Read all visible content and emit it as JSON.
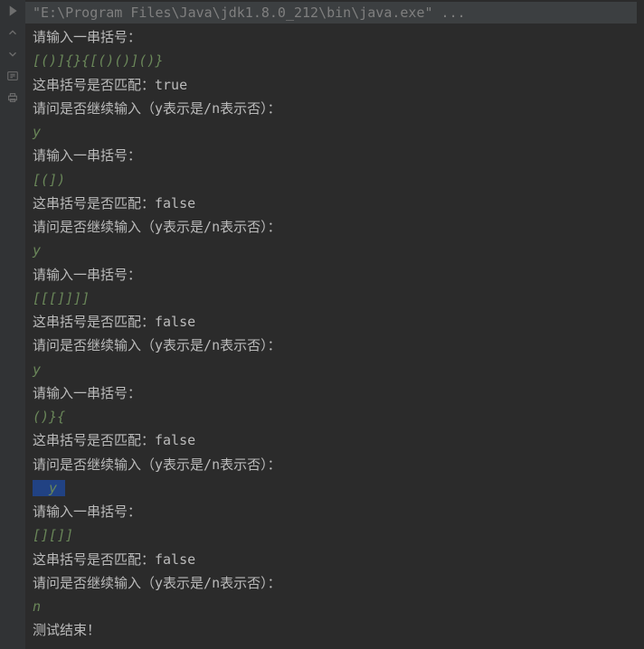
{
  "header": "\"E:\\Program Files\\Java\\jdk1.8.0_212\\bin\\java.exe\" ...",
  "lines": [
    {
      "type": "out",
      "text": "请输入一串括号："
    },
    {
      "type": "in",
      "text": "[()]{}{[()()]()}"
    },
    {
      "type": "out",
      "text": "这串括号是否匹配：true"
    },
    {
      "type": "out",
      "text": "请问是否继续输入（y表示是/n表示否）："
    },
    {
      "type": "in",
      "text": "y"
    },
    {
      "type": "out",
      "text": "请输入一串括号："
    },
    {
      "type": "in",
      "text": "[(])"
    },
    {
      "type": "out",
      "text": "这串括号是否匹配：false"
    },
    {
      "type": "out",
      "text": "请问是否继续输入（y表示是/n表示否）："
    },
    {
      "type": "in",
      "text": "y"
    },
    {
      "type": "out",
      "text": "请输入一串括号："
    },
    {
      "type": "in",
      "text": "[[[]]]]"
    },
    {
      "type": "out",
      "text": "这串括号是否匹配：false"
    },
    {
      "type": "out",
      "text": "请问是否继续输入（y表示是/n表示否）："
    },
    {
      "type": "in",
      "text": "y"
    },
    {
      "type": "out",
      "text": "请输入一串括号："
    },
    {
      "type": "in",
      "text": "()}{"
    },
    {
      "type": "out",
      "text": "这串括号是否匹配：false"
    },
    {
      "type": "out",
      "text": "请问是否继续输入（y表示是/n表示否）："
    },
    {
      "type": "in",
      "text": "  y ",
      "selected": true
    },
    {
      "type": "out",
      "text": "请输入一串括号："
    },
    {
      "type": "in",
      "text": "[][]]"
    },
    {
      "type": "out",
      "text": "这串括号是否匹配：false"
    },
    {
      "type": "out",
      "text": "请问是否继续输入（y表示是/n表示否）："
    },
    {
      "type": "in",
      "text": "n"
    },
    {
      "type": "out",
      "text": "测试结束！"
    }
  ]
}
